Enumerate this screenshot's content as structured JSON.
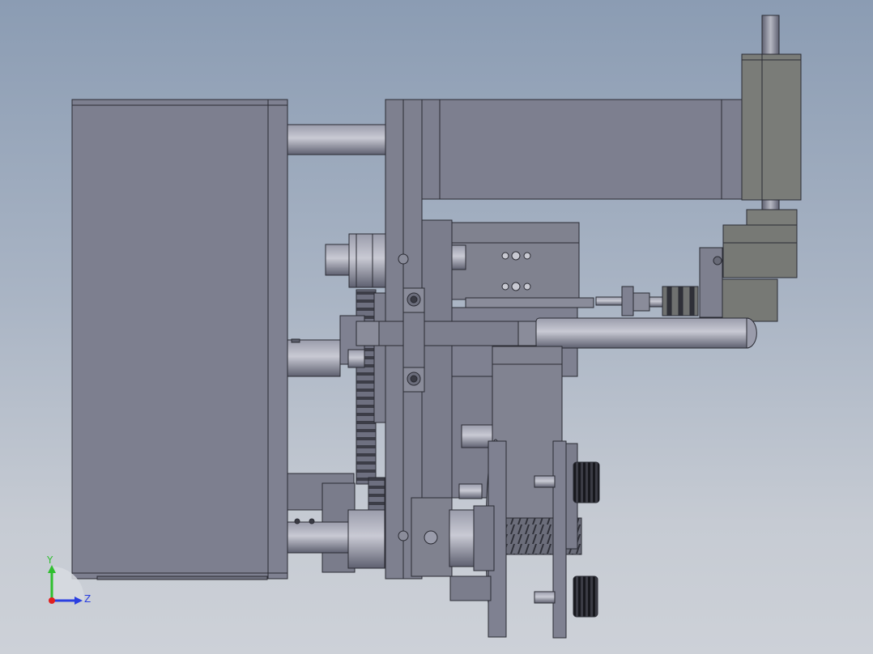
{
  "viewport": {
    "background_top": "#8b9cb3",
    "background_bottom": "#cdd1d8",
    "part_color": "#7f8191",
    "edge_color": "#2a2b33",
    "motor_color": "#7a7c78"
  },
  "triad": {
    "y_label": "Y",
    "z_label": "Z",
    "y_color": "#2fbf2f",
    "z_color": "#2a3fe0",
    "x_color": "#e02020"
  }
}
